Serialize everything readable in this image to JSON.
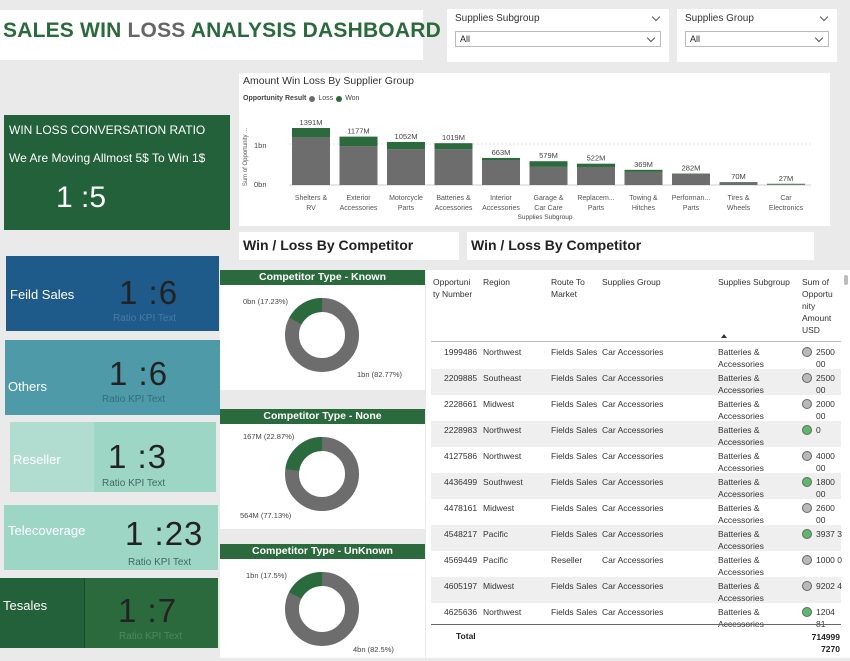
{
  "title": {
    "part1": "SALES WIN ",
    "part2": "LOSS",
    "part3": " ANALYSIS DASHBOARD"
  },
  "slicers": [
    {
      "label": "Supplies Subgroup",
      "value": "All"
    },
    {
      "label": "Supplies Group",
      "value": "All"
    }
  ],
  "ratio_card": {
    "heading": "WIN LOSS CONVERSATION RATIO",
    "subtext": "We Are Moving Allmost 5$ To Win 1$",
    "value": "1 :5"
  },
  "kpis": [
    {
      "name": "Feild Sales",
      "value": "1 :6",
      "sub": "Ratio KPI Text"
    },
    {
      "name": "Others",
      "value": "1 :6",
      "sub": "Ratio KPI Text"
    },
    {
      "name": "Reseller",
      "value": "1 :3",
      "sub": "Ratio KPI Text"
    },
    {
      "name": "Telecoverage",
      "value": "1 :23",
      "sub": "Ratio KPI Text"
    },
    {
      "name": "Tesales",
      "value": "1 :7",
      "sub": "Ratio KPI Text"
    }
  ],
  "colors": {
    "green": "#2a6a3c",
    "loss": "#6d6d6d",
    "blue": "#1e5a8a",
    "teal": "#4f9aa8",
    "mint": "#9ed6c6"
  },
  "bar_chart": {
    "title": "Amount Win Loss By Supplier Group",
    "legend_title": "Opportunity Result",
    "legend_loss": "Loss",
    "legend_won": "Won",
    "ylabel": "Sum of Opportunity ...",
    "xlabel": "Supplies Subgroup",
    "ytick_1": "1bn",
    "ytick_0": "0bn"
  },
  "chart_data": {
    "type": "bar",
    "title": "Amount Win Loss By Supplier Group",
    "xlabel": "Supplies Subgroup",
    "ylabel": "Sum of Opportunity ...",
    "ylim": [
      0,
      1.5
    ],
    "categories": [
      "Shelters & RV",
      "Exterior Accessories",
      "Motorcycle Parts",
      "Batteries & Accessories",
      "Interior Accessories",
      "Garage & Car Care",
      "Replacem... Parts",
      "Towing & Hitches",
      "Performan... Parts",
      "Tires & Wheels",
      "Car Electronics"
    ],
    "total_labels": [
      "1391M",
      "1177M",
      "1052M",
      "1019M",
      "663M",
      "579M",
      "522M",
      "369M",
      "282M",
      "70M",
      "27M"
    ],
    "series": [
      {
        "name": "Loss",
        "values": [
          1.17,
          0.95,
          0.87,
          0.87,
          0.61,
          0.45,
          0.44,
          0.32,
          0.27,
          0.06,
          0.02
        ]
      },
      {
        "name": "Won",
        "values": [
          0.22,
          0.23,
          0.18,
          0.15,
          0.05,
          0.13,
          0.08,
          0.05,
          0.01,
          0.01,
          0.01
        ]
      }
    ]
  },
  "headers": {
    "competitor_left": "Win  / Loss By Competitor",
    "competitor_right": "Win  / Loss By Competitor"
  },
  "donuts": [
    {
      "title": "Competitor Type - Known",
      "won_label": "0bn (17.23%)",
      "loss_label": "1bn (82.77%)",
      "won_pct": 17.23
    },
    {
      "title": "Competitor Type - None",
      "won_label": "167M (22.87%)",
      "loss_label": "564M (77.13%)",
      "won_pct": 22.87
    },
    {
      "title": "Competitor Type - UnKnown",
      "won_label": "1bn (17.5%)",
      "loss_label": "4bn (82.5%)",
      "won_pct": 17.5
    }
  ],
  "table": {
    "columns": [
      "Opportuni ty Number",
      "Region",
      "Route To Market",
      "Supplies Group",
      "Supplies Subgroup",
      "Sum of Opportu nity Amount USD"
    ],
    "rows": [
      {
        "num": "1999486",
        "region": "Northwest",
        "route": "Fields Sales",
        "group": "Car Accessories",
        "sub": "Batteries & Accessories",
        "won": false,
        "amount": "2500 00"
      },
      {
        "num": "2209885",
        "region": "Southeast",
        "route": "Fields Sales",
        "group": "Car Accessories",
        "sub": "Batteries & Accessories",
        "won": false,
        "amount": "2500 00"
      },
      {
        "num": "2228661",
        "region": "Midwest",
        "route": "Fields Sales",
        "group": "Car Accessories",
        "sub": "Batteries & Accessories",
        "won": false,
        "amount": "2000 00"
      },
      {
        "num": "2228983",
        "region": "Northwest",
        "route": "Fields Sales",
        "group": "Car Accessories",
        "sub": "Batteries & Accessories",
        "won": true,
        "amount": "0"
      },
      {
        "num": "4127586",
        "region": "Northwest",
        "route": "Fields Sales",
        "group": "Car Accessories",
        "sub": "Batteries & Accessories",
        "won": false,
        "amount": "4000 00"
      },
      {
        "num": "4436499",
        "region": "Southwest",
        "route": "Fields Sales",
        "group": "Car Accessories",
        "sub": "Batteries & Accessories",
        "won": true,
        "amount": "1800 00"
      },
      {
        "num": "4478161",
        "region": "Midwest",
        "route": "Fields Sales",
        "group": "Car Accessories",
        "sub": "Batteries & Accessories",
        "won": false,
        "amount": "2600 00"
      },
      {
        "num": "4548217",
        "region": "Pacific",
        "route": "Fields Sales",
        "group": "Car Accessories",
        "sub": "Batteries & Accessories",
        "won": true,
        "amount": "3937 3"
      },
      {
        "num": "4569449",
        "region": "Pacific",
        "route": "Reseller",
        "group": "Car Accessories",
        "sub": "Batteries & Accessories",
        "won": false,
        "amount": "1000 0"
      },
      {
        "num": "4605197",
        "region": "Midwest",
        "route": "Fields Sales",
        "group": "Car Accessories",
        "sub": "Batteries & Accessories",
        "won": false,
        "amount": "9202 4"
      },
      {
        "num": "4625636",
        "region": "Northwest",
        "route": "Fields Sales",
        "group": "Car Accessories",
        "sub": "Batteries & Accessories",
        "won": true,
        "amount": "1204 81"
      }
    ],
    "total_label": "Total",
    "total_value": "714999 7270"
  }
}
